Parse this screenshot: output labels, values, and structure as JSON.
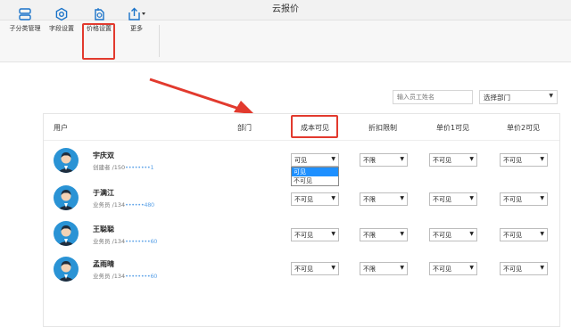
{
  "window": {
    "title": "云报价"
  },
  "toolbar": {
    "items": [
      {
        "label": "子分类管理",
        "icon": "subcategory-icon"
      },
      {
        "label": "字段设置",
        "icon": "gear-icon"
      },
      {
        "label": "价格设置",
        "icon": "price-tag-icon"
      },
      {
        "label": "更多",
        "icon": "share-more-icon"
      }
    ]
  },
  "filters": {
    "search_placeholder": "输入员工姓名",
    "department_label": "选择部门"
  },
  "table": {
    "headers": {
      "user": "用户",
      "dept": "部门",
      "cost": "成本可见",
      "discount": "折扣限制",
      "price1": "单价1可见",
      "price2": "单价2可见"
    },
    "rows": [
      {
        "name": "宇庆双",
        "role": "创建者 /150",
        "phone_blur": "••••••••1",
        "cost": "可见",
        "discount": "不限",
        "price1": "不可见",
        "price2": "不可见"
      },
      {
        "name": "于满江",
        "role": "业务员 /134",
        "phone_blur": "••••••480",
        "cost": "不可见",
        "discount": "不限",
        "price1": "不可见",
        "price2": "不可见"
      },
      {
        "name": "王聪聪",
        "role": "业务员 /134",
        "phone_blur": "••••••••60",
        "cost": "不可见",
        "discount": "不限",
        "price1": "不可见",
        "price2": "不可见"
      },
      {
        "name": "孟雨晴",
        "role": "业务员 /134",
        "phone_blur": "••••••••60",
        "cost": "不可见",
        "discount": "不限",
        "price1": "不可见",
        "price2": "不可见"
      }
    ],
    "dropdown_options": [
      "可见",
      "不可见"
    ]
  },
  "colors": {
    "highlight": "#e23a2e",
    "avatar": "#2a93d5",
    "selected_option": "#1e90ff"
  }
}
